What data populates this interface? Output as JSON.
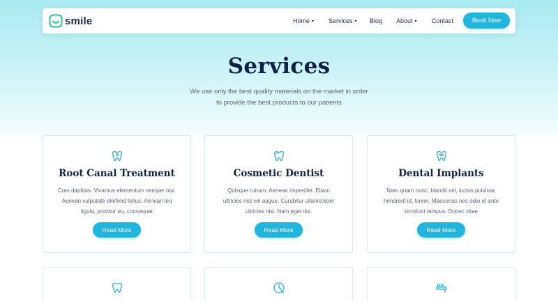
{
  "brand": {
    "name": "smile",
    "accent": "#21b4dc",
    "dark": "#0f2246"
  },
  "nav": {
    "home": "Home",
    "services": "Services",
    "blog": "Blog",
    "about": "About",
    "contact": "Contact",
    "cta": "Book Now"
  },
  "hero": {
    "title": "Services",
    "subtitle_line1": "We use only the best quality materials on the market in order",
    "subtitle_line2": "to provide the best products to our patients"
  },
  "cards": [
    {
      "icon": "tooth-icon",
      "title": "Root Canal Treatment",
      "desc": [
        "Cras dapibus. Vivamus elementum semper nisi.",
        "Aenean vulputate eleifend tellus. Aenean leo",
        "ligula, porttitor eu, consequat"
      ],
      "button": "Read More"
    },
    {
      "icon": "tooth-icon",
      "title": "Cosmetic Dentist",
      "desc": [
        "Quisque rutrum. Aenean imperdiet. Etiam",
        "ultricies nisi vel augue. Curabitur ullamcorper",
        "ultricies nisi. Nam eget dui."
      ],
      "button": "Read More"
    },
    {
      "icon": "tooth-icon",
      "title": "Dental Implants",
      "desc": [
        "Nam quam nunc, blandit vel, luctus pulvinar,",
        "hendrerit id, lorem. Maecenas nec odio et ante",
        "tincidunt tempus. Donec vitae"
      ],
      "button": "Read More"
    },
    {
      "icon": "tooth-icon"
    },
    {
      "icon": "dental-clinic-icon"
    },
    {
      "icon": "toothbrush-icon"
    }
  ]
}
